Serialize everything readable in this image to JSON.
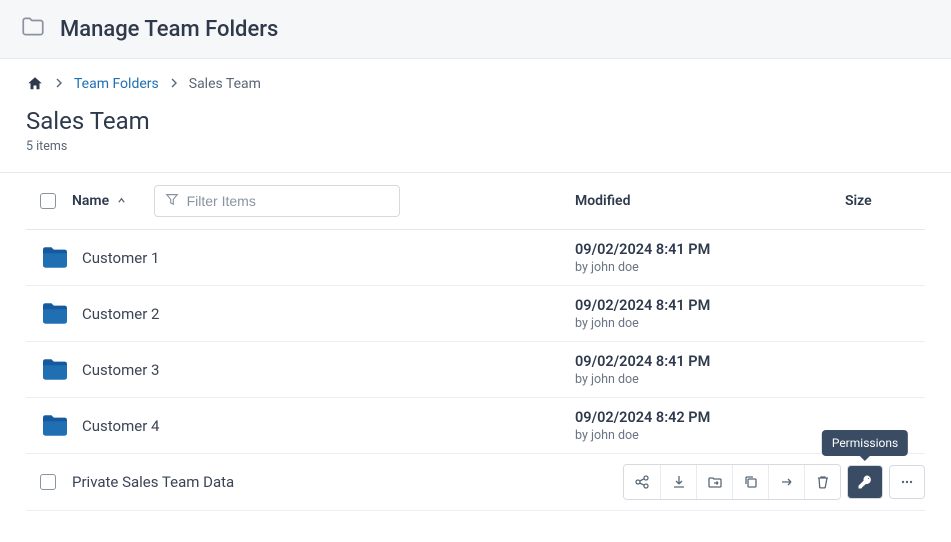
{
  "header": {
    "title": "Manage Team Folders"
  },
  "breadcrumb": {
    "link1": "Team Folders",
    "current": "Sales Team"
  },
  "page": {
    "title": "Sales Team",
    "count": "5 items"
  },
  "columns": {
    "name": "Name",
    "modified": "Modified",
    "size": "Size"
  },
  "filter": {
    "placeholder": "Filter Items"
  },
  "rows": [
    {
      "name": "Customer 1",
      "mod_date": "09/02/2024 8:41 PM",
      "mod_by": "by john doe"
    },
    {
      "name": "Customer 2",
      "mod_date": "09/02/2024 8:41 PM",
      "mod_by": "by john doe"
    },
    {
      "name": "Customer 3",
      "mod_date": "09/02/2024 8:41 PM",
      "mod_by": "by john doe"
    },
    {
      "name": "Customer 4",
      "mod_date": "09/02/2024 8:42 PM",
      "mod_by": "by john doe"
    }
  ],
  "selected_row": {
    "name": "Private Sales Team Data"
  },
  "tooltip": {
    "permissions": "Permissions"
  }
}
